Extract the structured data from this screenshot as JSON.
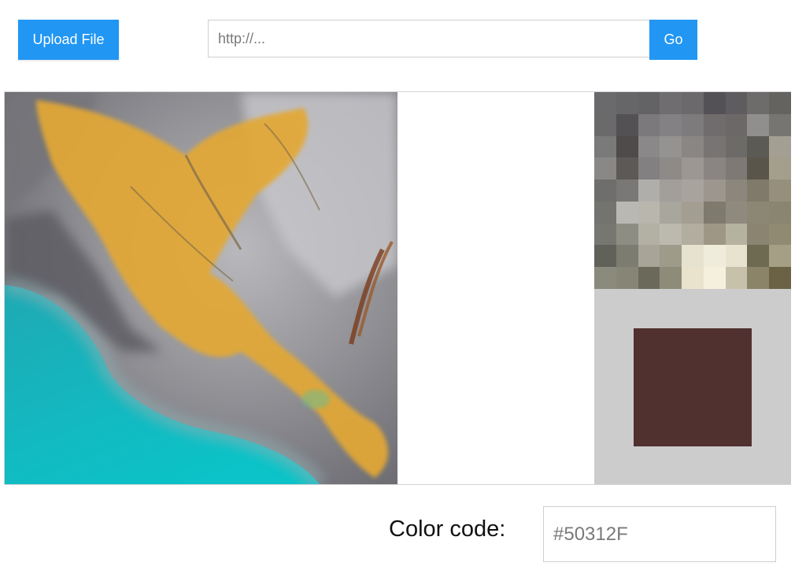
{
  "toolbar": {
    "upload_label": "Upload File",
    "url_placeholder": "http://...",
    "url_value": "",
    "go_label": "Go"
  },
  "picker": {
    "selected_color": "#50312F",
    "swatch_background": "#CCCCCC",
    "zoom_pixels": [
      "#6a6a6c",
      "#666668",
      "#636365",
      "#6f6d70",
      "#6b696c",
      "#535056",
      "#5f5c60",
      "#6e6b6b",
      "#656360",
      "#6a6a6b",
      "#535154",
      "#7b797b",
      "#838183",
      "#7d7b7c",
      "#706c6d",
      "#6c6868",
      "#918f8e",
      "#767571",
      "#7a7a7a",
      "#4f4b4a",
      "#8a8888",
      "#959292",
      "#8a8684",
      "#787473",
      "#6d6b67",
      "#5c5a55",
      "#a39f93",
      "#8a8886",
      "#5c5957",
      "#828080",
      "#8d8a88",
      "#9c9792",
      "#8a8582",
      "#7d7a75",
      "#5a554a",
      "#a49e8c",
      "#6e6e6c",
      "#7a7876",
      "#b0aeaa",
      "#a29f9b",
      "#a9a39e",
      "#9c968e",
      "#8c877c",
      "#7f7a6a",
      "#958f7c",
      "#737370",
      "#b9b8b2",
      "#b8b6ad",
      "#a8a69d",
      "#a39e92",
      "#7f7a6e",
      "#8f8a7e",
      "#8c8775",
      "#8a8570",
      "#777771",
      "#8e8d84",
      "#b3b0a4",
      "#bcbaaf",
      "#b2ae9f",
      "#9e9786",
      "#b6b2a0",
      "#8b8470",
      "#908a73",
      "#60625a",
      "#7c7c70",
      "#a8a598",
      "#9e9b8b",
      "#e6e2d0",
      "#f0ecdc",
      "#e8e3cf",
      "#6e6a52",
      "#a59f85",
      "#8a8a7d",
      "#878676",
      "#6b6a5a",
      "#8e8c78",
      "#e9e3ce",
      "#f5f0de",
      "#c7c1ab",
      "#8b8469",
      "#6b6246"
    ]
  },
  "footer": {
    "color_code_label": "Color code:",
    "color_code_value": "#50312F"
  }
}
